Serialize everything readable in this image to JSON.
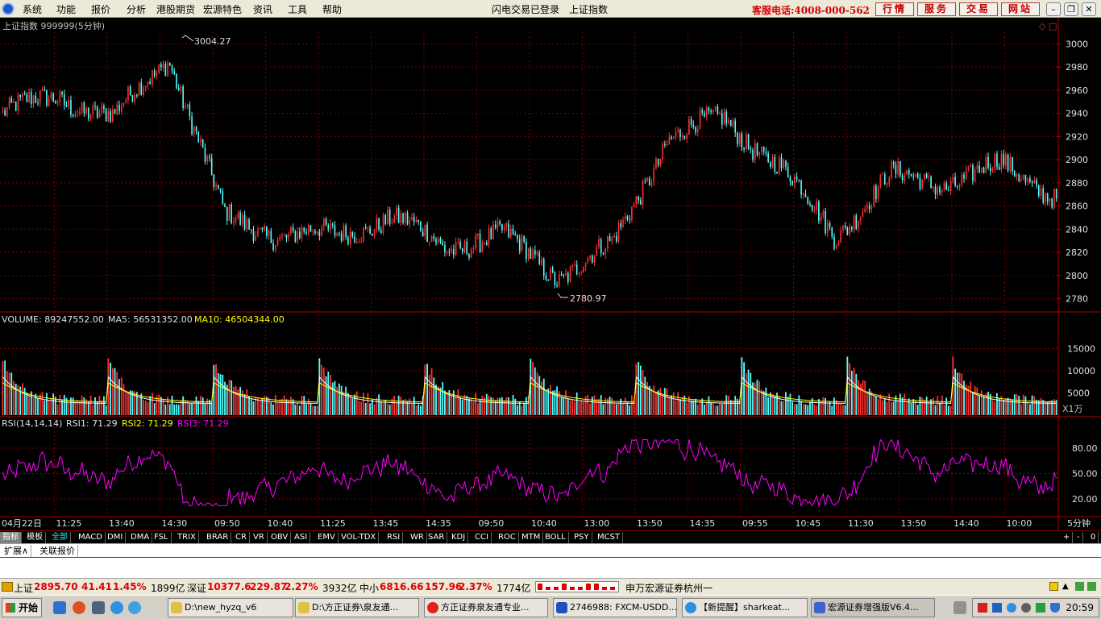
{
  "menu": {
    "items": [
      "系统",
      "功能",
      "报价",
      "分析",
      "港股期货",
      "宏源特色",
      "资讯",
      "工具",
      "帮助"
    ],
    "center": [
      "闪电交易已登录",
      "上证指数"
    ],
    "hotline": "客服电话:4008-000-562",
    "tabs": [
      "行情",
      "服务",
      "交易",
      "网站"
    ]
  },
  "chart": {
    "title": "上证指数 999999(5分钟)",
    "high_label": "3004.27",
    "low_label": "2780.97",
    "price_ticks": [
      "3000",
      "2980",
      "2960",
      "2940",
      "2920",
      "2900",
      "2880",
      "2860",
      "2840",
      "2820",
      "2800",
      "2780"
    ],
    "volume_header": {
      "vol": "VOLUME: 89247552.00",
      "ma5": "MA5: 56531352.00",
      "ma10": "MA10: 46504344.00"
    },
    "volume_ticks": [
      "15000",
      "10000",
      "5000"
    ],
    "volume_unit": "X1万",
    "rsi_header": {
      "name": "RSI(14,14,14)",
      "rsi1": "RSI1: 71.29",
      "rsi2": "RSI2: 71.29",
      "rsi3": "RSI3: 71.29"
    },
    "rsi_ticks": [
      "80.00",
      "50.00",
      "20.00"
    ],
    "time_labels": [
      "04月22日",
      "11:25",
      "13:40",
      "14:30",
      "09:50",
      "10:40",
      "11:25",
      "13:45",
      "14:35",
      "09:50",
      "10:40",
      "13:00",
      "13:50",
      "14:35",
      "09:55",
      "10:45",
      "11:30",
      "13:50",
      "14:40",
      "10:00"
    ],
    "period": "5分钟",
    "colors": {
      "up": "#ff3030",
      "down": "#54ffff",
      "grid": "#800000",
      "rsi": "#ff00ff",
      "ma5": "#ffffff",
      "ma10": "#ffff00"
    }
  },
  "chart_data": {
    "type": "candlestick",
    "title": "上证指数 999999(5分钟)",
    "ylim": [
      2770,
      3010
    ],
    "annotations": [
      {
        "label": "3004.27",
        "kind": "high"
      },
      {
        "label": "2780.97",
        "kind": "low"
      }
    ],
    "close_trend": [
      {
        "x": "04月22日",
        "y": 2940
      },
      {
        "x": "11:25",
        "y": 2955
      },
      {
        "x": "13:40",
        "y": 2935
      },
      {
        "x": "14:30",
        "y": 2990
      },
      {
        "x": "09:50",
        "y": 2850
      },
      {
        "x": "10:40",
        "y": 2835
      },
      {
        "x": "11:25",
        "y": 2835
      },
      {
        "x": "13:45",
        "y": 2850
      },
      {
        "x": "14:35",
        "y": 2825
      },
      {
        "x": "09:50",
        "y": 2835
      },
      {
        "x": "10:40",
        "y": 2800
      },
      {
        "x": "13:00",
        "y": 2825
      },
      {
        "x": "13:50",
        "y": 2920
      },
      {
        "x": "14:35",
        "y": 2935
      },
      {
        "x": "09:55",
        "y": 2895
      },
      {
        "x": "10:45",
        "y": 2835
      },
      {
        "x": "11:30",
        "y": 2885
      },
      {
        "x": "13:50",
        "y": 2880
      },
      {
        "x": "14:40",
        "y": 2895
      },
      {
        "x": "10:00",
        "y": 2870
      }
    ],
    "volume_ylim": [
      0,
      20000
    ],
    "rsi_ylim": [
      0,
      100
    ]
  },
  "tabs": {
    "left": [
      "指标",
      "模板",
      "全部"
    ],
    "indicators": [
      "MACD",
      "DMI",
      "DMA",
      "FSL",
      "TRIX",
      "BRAR",
      "CR",
      "VR",
      "OBV",
      "ASI",
      "EMV",
      "VOL-TDX",
      "RSI",
      "WR",
      "SAR",
      "KDJ",
      "CCI",
      "ROC",
      "MTM",
      "BOLL",
      "PSY",
      "MCST"
    ],
    "right": [
      "+",
      "-",
      "0"
    ]
  },
  "ext_tabs": [
    "扩展∧",
    "关联报价"
  ],
  "status": {
    "sh_label": "上证",
    "sh_value": "2895.70",
    "sh_change": "41.41",
    "sh_pct": "1.45%",
    "sh_amount": "1899亿",
    "sz_label": "深证",
    "sz_value": "10377.6",
    "sz_change": "229.87",
    "sz_pct": "2.27%",
    "sz_amount": "3932亿",
    "zx_label": "中小",
    "zx_value": "6816.66",
    "zx_change": "157.96",
    "zx_pct": "2.37%",
    "zx_amount": "1774亿",
    "broker": "申万宏源证券杭州一"
  },
  "taskbar": {
    "start": "开始",
    "items": [
      "D:\\new_hyzq_v6",
      "D:\\方正证券\\泉友通...",
      "方正证券泉友通专业...",
      "2746988: FXCM-USDD...",
      "【新提醒】sharkeat...",
      "宏源证券增强版V6.4..."
    ],
    "clock": "20:59"
  }
}
